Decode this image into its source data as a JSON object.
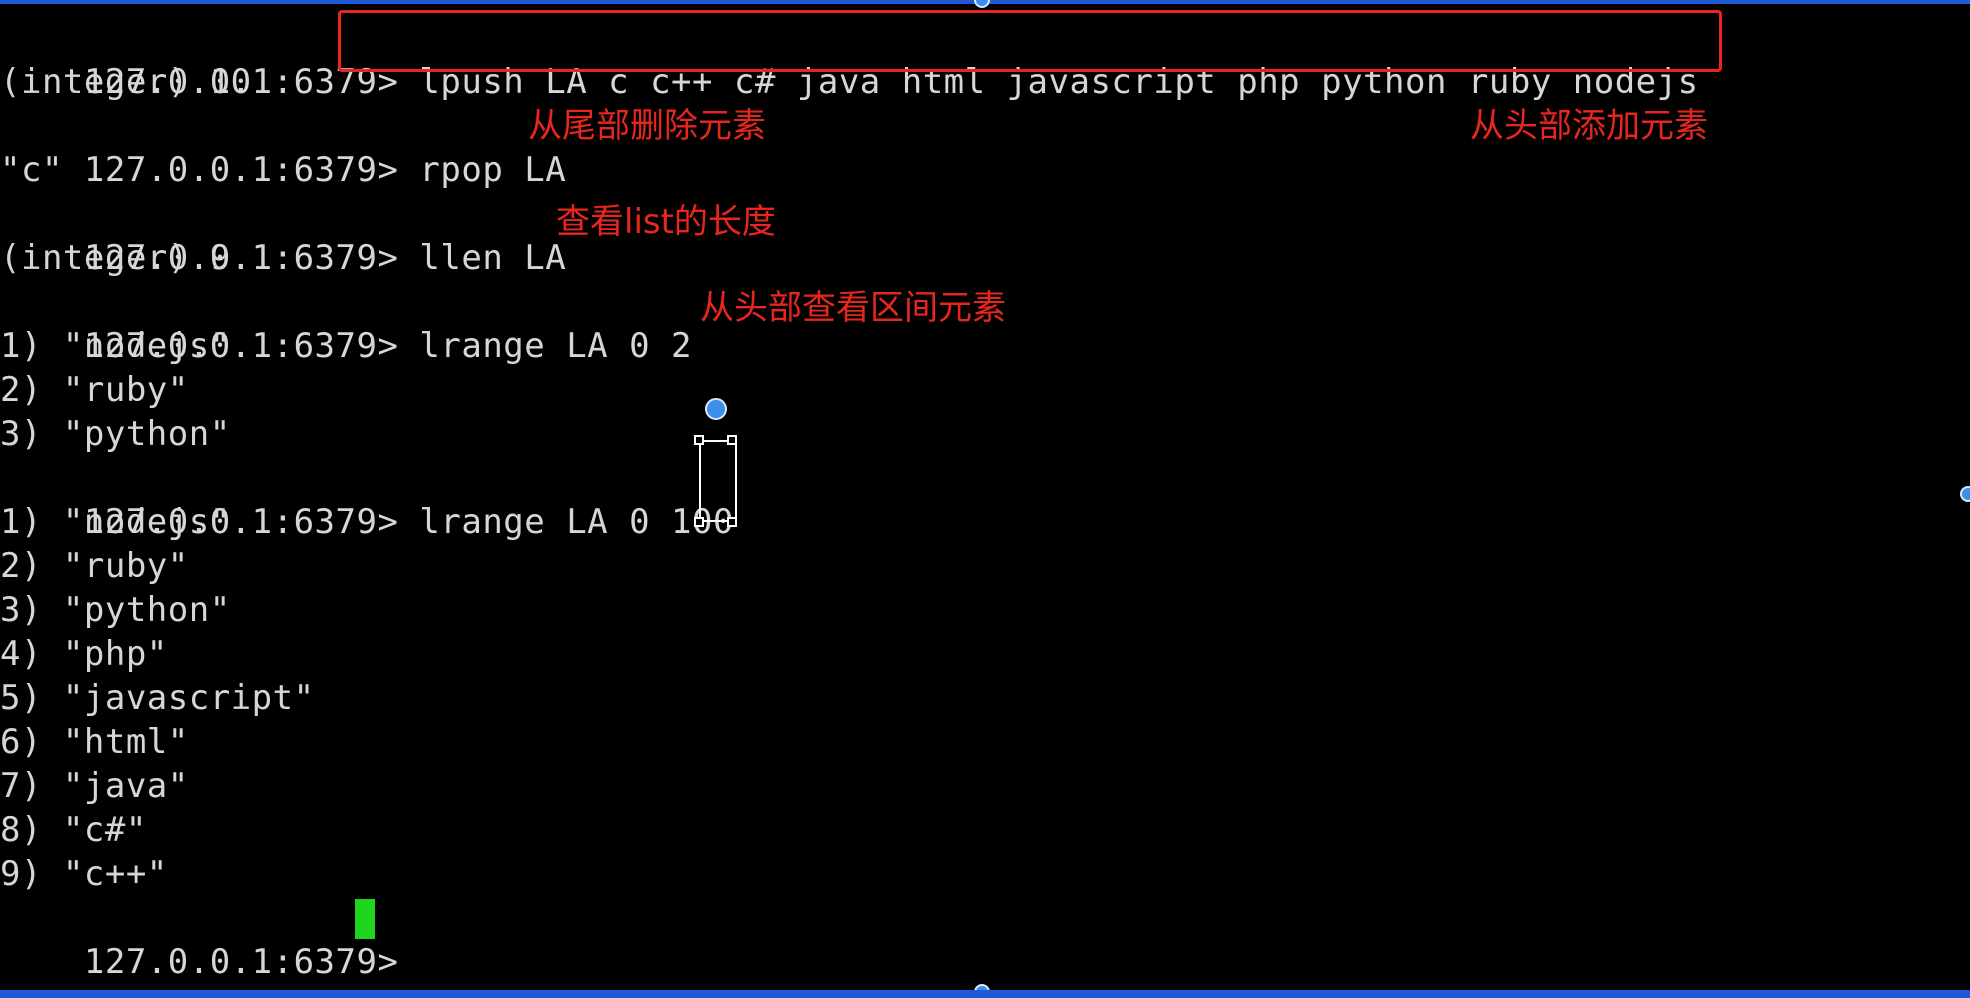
{
  "terminal": {
    "prompt": "127.0.0.1:6379>",
    "lines": [
      {
        "type": "command",
        "cmd": "lpush LA c c++ c# java html javascript php python ruby nodejs"
      },
      {
        "type": "output",
        "text": "(integer) 10"
      },
      {
        "type": "command",
        "cmd": "rpop LA"
      },
      {
        "type": "output",
        "text": "\"c\""
      },
      {
        "type": "command",
        "cmd": "llen LA"
      },
      {
        "type": "output",
        "text": "(integer) 9"
      },
      {
        "type": "command",
        "cmd": "lrange LA 0 2"
      },
      {
        "type": "output",
        "text": "1) \"nodejs\""
      },
      {
        "type": "output",
        "text": "2) \"ruby\""
      },
      {
        "type": "output",
        "text": "3) \"python\""
      },
      {
        "type": "command",
        "cmd": "lrange LA 0 100"
      },
      {
        "type": "output",
        "text": "1) \"nodejs\""
      },
      {
        "type": "output",
        "text": "2) \"ruby\""
      },
      {
        "type": "output",
        "text": "3) \"python\""
      },
      {
        "type": "output",
        "text": "4) \"php\""
      },
      {
        "type": "output",
        "text": "5) \"javascript\""
      },
      {
        "type": "output",
        "text": "6) \"html\""
      },
      {
        "type": "output",
        "text": "7) \"java\""
      },
      {
        "type": "output",
        "text": "8) \"c#\""
      },
      {
        "type": "output",
        "text": "9) \"c++\""
      },
      {
        "type": "command",
        "cmd": ""
      }
    ]
  },
  "annotations": {
    "lpush": "从头部添加元素",
    "rpop": "从尾部删除元素",
    "llen": "查看list的长度",
    "lrange": "从头部查看区间元素"
  },
  "colors": {
    "background": "#000000",
    "text": "#d6d6d6",
    "annotation": "#e8261e",
    "cursor": "#1ed61e"
  }
}
